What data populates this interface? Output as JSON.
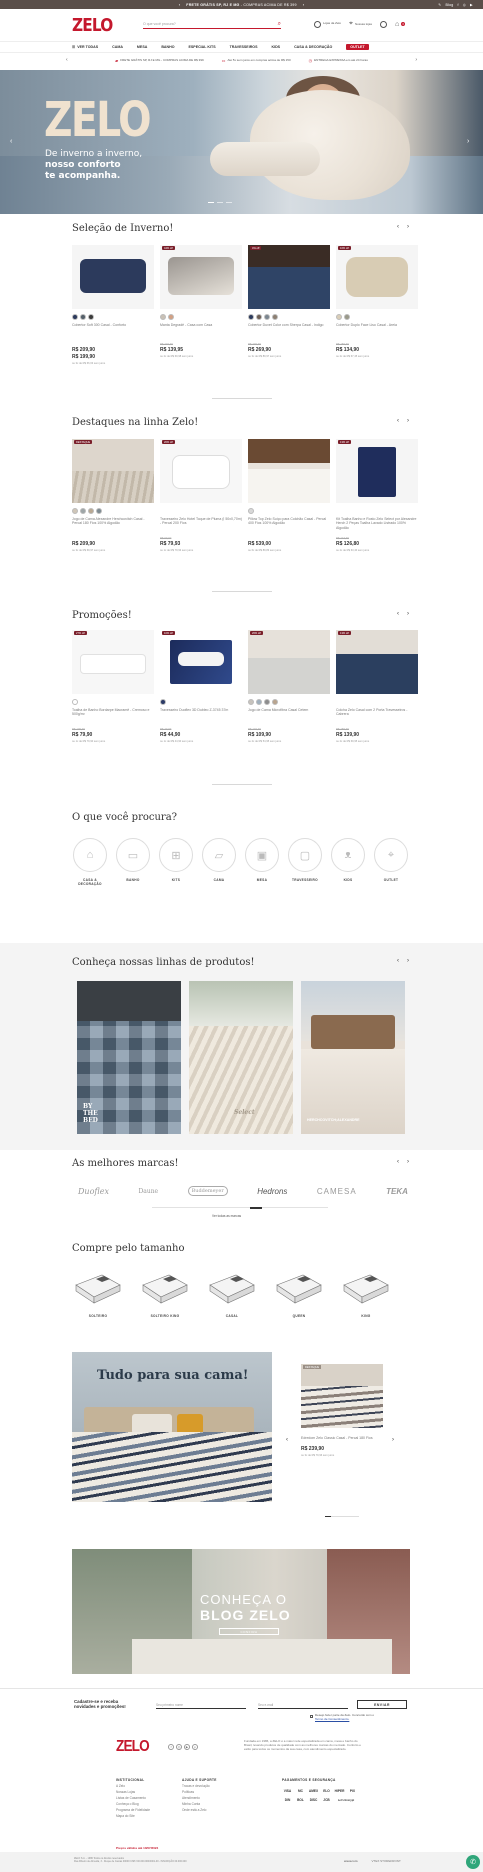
{
  "topbar": {
    "text_a": "FRETE GRÁTIS SP, RJ E MG",
    "text_b": " - COMPRAS ACIMA DE R$ 399",
    "blog": "Blog"
  },
  "header": {
    "logo": "ZELO",
    "search_placeholder": "O que você procura?",
    "icons": [
      {
        "icon": "truck-icon",
        "label": "Lojas da\nZelo",
        "short": "Lojas da Zelo"
      },
      {
        "icon": "map-pin-icon",
        "label": "Nossas lojas",
        "short": "Nossas lojas"
      },
      {
        "icon": "user-icon",
        "label": "",
        "short": ""
      },
      {
        "icon": "cart-icon",
        "label": "",
        "short": ""
      }
    ],
    "cart_count": "0"
  },
  "nav": {
    "items": [
      "VER TODAS",
      "CAMA",
      "MESA",
      "BANHO",
      "ESPECIAL KITS",
      "TRAVESSEIROS",
      "KIDS",
      "CASA & DECORAÇÃO"
    ],
    "outlet": "OUTLET"
  },
  "promos": [
    "FRETE GRÁTIS SP, RJ E MG - COMPRAS ACIMA DE R$ 399",
    "Até 5x sem juros em compras acima de R$ 150",
    "ENTREGA EXPRESSA em até 24 horas"
  ],
  "hero": {
    "title": "ZELO",
    "sub1": "De inverno a inverno,",
    "sub2": "nosso conforto",
    "sub3": "te acompanha."
  },
  "sections": {
    "winter": {
      "title": "Seleção de Inverno!",
      "products": [
        {
          "badge": "",
          "name": "Cobertor Soft 300 Casal - Conforto",
          "old": "",
          "price": "R$ 209,90",
          "price2": "R$ 199,90",
          "inst": "ou 3x de R$ 66,63 sem juros",
          "swatches": [
            "#2c3a5c",
            "#55606a",
            "#3b3b3b"
          ],
          "img": "navy"
        },
        {
          "badge": "44% off",
          "name": "Manta Degradê - Casa com Casa",
          "old": "R$ 249,90",
          "price": "R$ 139,95",
          "price2": "",
          "inst": "ou 2x de R$ 69,98 sem juros",
          "swatches": [
            "#c9c1b6",
            "#d2a184"
          ],
          "img": "grey"
        },
        {
          "badge": "4% off",
          "name": "Cobertor Duvet Color com Sherpa Casal - Indigo",
          "old": "R$ 279,90",
          "price": "R$ 269,90",
          "price2": "",
          "inst": "ou 3x de R$ 89,97 sem juros",
          "swatches": [
            "#2c3a5c",
            "#6e5f55",
            "#7b8690",
            "#8c7f72"
          ],
          "img": "bedblue"
        },
        {
          "badge": "16% off",
          "name": "Cobertor Duplo Face Liso Casal - Areia",
          "old": "R$ 159,90",
          "price": "R$ 134,90",
          "price2": "",
          "inst": "ou 2x de R$ 67,45 sem juros",
          "swatches": [
            "#d9cdb8",
            "#9a9a8a"
          ],
          "img": "beige"
        }
      ]
    },
    "highlights": {
      "title": "Destaques na linha Zelo!",
      "products": [
        {
          "badge": "DESTAQUE",
          "name": "Jogo de Cama Alexandre Herchcovitch Casal - Percal 180 Fios 100% Algodão",
          "old": "",
          "price": "R$ 209,90",
          "price2": "",
          "inst": "ou 3x de R$ 69,97 sem juros",
          "swatches": [
            "#cfc6b8",
            "#9ea6a8",
            "#b9a993",
            "#7d8b92"
          ],
          "img": "bedroom"
        },
        {
          "badge": "20% off",
          "name": "Travesseiro Zelo Hotel Toque de Pluma (I 50x0,70m) - Percal 200 Fios",
          "old": "R$ 99,90",
          "price": "R$ 79,93",
          "price2": "",
          "inst": "ou 1x de R$ 79,93 sem juros",
          "swatches": [],
          "img": "pillow"
        },
        {
          "badge": "",
          "name": "Pillow Top Zelo Suíço para Colchão Casal - Percal 400 Fios 100% Algodão",
          "old": "",
          "price": "R$ 539,00",
          "price2": "",
          "inst": "ou 6x de R$ 89,83 sem juros",
          "swatches": [
            "#d8d8d8"
          ],
          "img": "mattress"
        },
        {
          "badge": "13% off",
          "name": "Kit Toalha Banho e Rosto Zelo Select por Alexandre Herch 2 Peças Toalha Lavado Listrado 100% Algodão",
          "old": "R$ 144,90",
          "price": "R$ 126,80",
          "price2": "",
          "inst": "ou 2x de R$ 63,40 sem juros",
          "swatches": [],
          "img": "towelnavy"
        }
      ]
    },
    "promotions": {
      "title": "Promoções!",
      "products": [
        {
          "badge": "27% off",
          "name": "Toalha de Banho Bordarpe Macramê - Cremoso e 500g/m²",
          "old": "R$ 109,90",
          "price": "R$ 79,90",
          "price2": "",
          "inst": "ou 1x de R$ 79,90 sem juros",
          "swatches": [
            "#ffffff"
          ],
          "img": "towelwhite"
        },
        {
          "badge": "10% off",
          "name": "Travesseiro Duoflex 3D Dubleo Z-3745 37m",
          "old": "R$ 49,99",
          "price": "R$ 44,90",
          "price2": "",
          "inst": "ou 1x de R$ 44,90 sem juros",
          "swatches": [
            "#2b3a66"
          ],
          "img": "pillowbox"
        },
        {
          "badge": "26% off",
          "name": "Jogo de Cama Microfibra Casal Cetem",
          "old": "R$ 149,90",
          "price": "R$ 109,90",
          "price2": "",
          "inst": "ou 2x de R$ 54,95 sem juros",
          "swatches": [
            "#c7c3bd",
            "#a0b0bd",
            "#8d8d8d",
            "#b9a58f"
          ],
          "img": "bedgrey"
        },
        {
          "badge": "13% off",
          "name": "Colcha Zelo Casal com 2 Porta Travesseiros - Cabrera",
          "old": "R$ 159,90",
          "price": "R$ 139,90",
          "price2": "",
          "inst": "ou 2x de R$ 69,95 sem juros",
          "swatches": [],
          "img": "bednavy"
        }
      ]
    }
  },
  "categories": {
    "title": "O que você procura?",
    "items": [
      {
        "label": "CASA &\nDECORAÇÃO",
        "icon": "home-icon",
        "glyph": "⌂"
      },
      {
        "label": "BANHO",
        "icon": "towel-icon",
        "glyph": "▭"
      },
      {
        "label": "KITS",
        "icon": "gift-icon",
        "glyph": "⊞"
      },
      {
        "label": "CAMA",
        "icon": "bed-icon",
        "glyph": "▱"
      },
      {
        "label": "MESA",
        "icon": "table-icon",
        "glyph": "▣"
      },
      {
        "label": "TRAVESSEIRO",
        "icon": "pillow-icon",
        "glyph": "▢"
      },
      {
        "label": "KIDS",
        "icon": "bear-icon",
        "glyph": "ᴥ"
      },
      {
        "label": "OUTLET",
        "icon": "tag-icon",
        "glyph": "⌖"
      }
    ]
  },
  "lines": {
    "title": "Conheça nossas linhas de produtos!",
    "items": [
      {
        "label": "BY\nTHE\nBED",
        "img": "plaid"
      },
      {
        "label": "Select",
        "img": "stripes"
      },
      {
        "label": "HERCHCOVITCH;ALEXANDRE",
        "img": "woodbed"
      }
    ]
  },
  "brands": {
    "title": "As melhores marcas!",
    "items": [
      "Duoflex",
      "Daune",
      "Buddemeyer",
      "Hedrons",
      "CAMESA",
      "TEKA"
    ],
    "more": "Ver todas as marcas"
  },
  "sizes": {
    "title": "Compre pelo tamanho",
    "items": [
      "SOLTEIRO",
      "SOLTEIRO KING",
      "CASAL",
      "QUEEN",
      "KING"
    ]
  },
  "banner": {
    "title": "Tudo para sua cama!",
    "product": {
      "badge": "DESTAQUE",
      "name": "Edredom Zelo Classic Casal - Percal 180 Fios",
      "price": "R$ 239,90",
      "inst": "ou 3x de R$ 79,96 sem juros"
    }
  },
  "blog": {
    "line1": "CONHEÇA O",
    "line2": "BLOG ZELO",
    "button": "CONFIRA"
  },
  "newsletter": {
    "title1": "Cadastre-se e receba",
    "title2": "novidades e promoções!",
    "name_placeholder": "Seu primeiro nome",
    "email_placeholder": "Seu e-mail",
    "button": "ENVIAR",
    "consent1": "Desejo fazer parte da Zelo. Concordo com o",
    "consent2": "Termo de Consentimento."
  },
  "footer": {
    "logo": "ZELO",
    "about": "Fundada em 1986, a ZELO é a maior rede especializada em cama, mesa e banho do Brasil, levando produtos de qualidade com as melhores marcas do mercado. Conforto e estilo para todos os momentos da sua casa, com atendimento especializado.",
    "col1_title": "INSTITUCIONAL",
    "col1": [
      "A Zelo",
      "Nossas Lojas",
      "Listas de Casamento",
      "Conheça o Blog",
      "Programa de Fidelidade",
      "Mapa do Site"
    ],
    "col2_title": "AJUDA E SUPORTE",
    "col2": [
      "Trocas e devolução",
      "Políticas",
      "Atendimento",
      "Minha Conta",
      "Onde está a Zelo"
    ],
    "col3_title": "PAGAMENTOS E SEGURANÇA",
    "payments": [
      "VISA",
      "MC",
      "AMEX",
      "ELO",
      "HIPER",
      "PIX",
      "DIN",
      "BOL",
      "DISC",
      "JCB",
      "Let's Encrypt",
      ""
    ],
    "date": "Preços válidos até 10/07/2024",
    "legal": "ZELO S.A. - 1986 Todos os direitos reservados\nRua Ribeiro de Almeida, 3 - Duque de Caxias 00000 CNPJ 00.000.000/0001-00 - INSCRIÇÃO 00.000.000",
    "dev": "wavecom",
    "vtex": "VTEX STOREFRONT"
  },
  "colors": {
    "brand": "#c4182d",
    "badge": "#7a1f2a",
    "topbar": "#5a4e49"
  }
}
